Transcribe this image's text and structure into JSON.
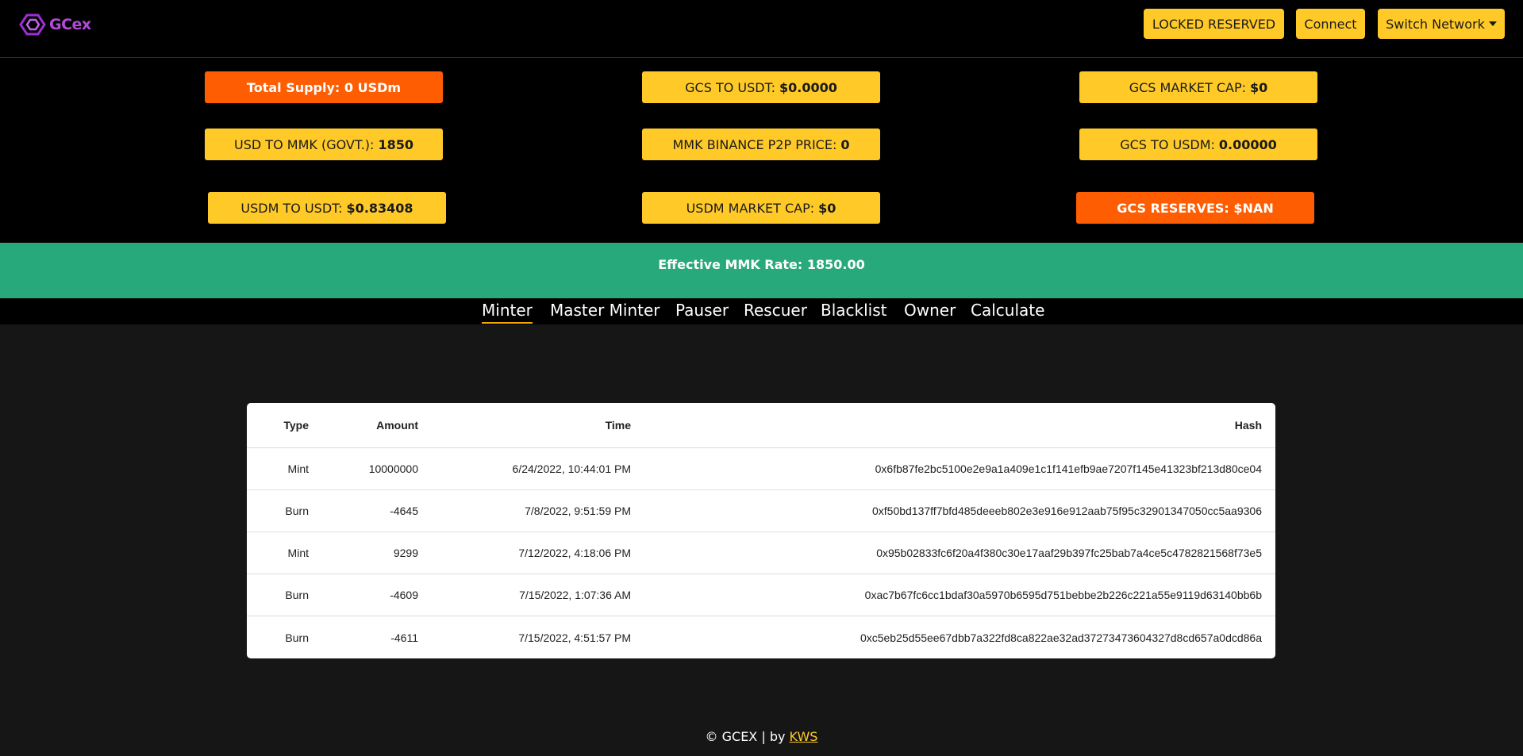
{
  "header": {
    "logo_text": "GCex",
    "locked_reserved_label": "LOCKED RESERVED",
    "connect_label": "Connect",
    "switch_network_label": "Switch Network"
  },
  "stats": {
    "total_supply": {
      "label": "Total Supply:",
      "value": "0 USDm"
    },
    "gcs_to_usdt": {
      "label": "GCS TO USDT:",
      "value": "$0.0000"
    },
    "gcs_market_cap": {
      "label": "GCS MARKET CAP:",
      "value": "$0"
    },
    "usd_to_mmk": {
      "label": "USD TO MMK (GOVT.):",
      "value": "1850"
    },
    "mmk_binance_p2p": {
      "label": "MMK BINANCE P2P PRICE:",
      "value": "0"
    },
    "gcs_to_usdm": {
      "label": "GCS TO USDM:",
      "value": "0.00000"
    },
    "usdm_to_usdt": {
      "label": "USDM TO USDT:",
      "value": "$0.83408"
    },
    "usdm_market_cap": {
      "label": "USDM MARKET CAP:",
      "value": "$0"
    },
    "gcs_reserves": {
      "label": "GCS RESERVES:",
      "value": "$NAN"
    }
  },
  "banner": {
    "text": "Effective MMK Rate: 1850.00"
  },
  "tabs": [
    {
      "label": "Minter",
      "active": true
    },
    {
      "label": "Master Minter"
    },
    {
      "label": "Pauser"
    },
    {
      "label": "Rescuer"
    },
    {
      "label": "Blacklist"
    },
    {
      "label": "Owner"
    },
    {
      "label": "Calculate"
    }
  ],
  "table": {
    "columns": [
      "Type",
      "Amount",
      "Time",
      "Hash"
    ],
    "rows": [
      [
        "Mint",
        "10000000",
        "6/24/2022, 10:44:01 PM",
        "0x6fb87fe2bc5100e2e9a1a409e1c1f141efb9ae7207f145e41323bf213d80ce04"
      ],
      [
        "Burn",
        "-4645",
        "7/8/2022, 9:51:59 PM",
        "0xf50bd137ff7bfd485deeeb802e3e916e912aab75f95c32901347050cc5aa9306"
      ],
      [
        "Mint",
        "9299",
        "7/12/2022, 4:18:06 PM",
        "0x95b02833fc6f20a4f380c30e17aaf29b397fc25bab7a4ce5c4782821568f73e5"
      ],
      [
        "Burn",
        "-4609",
        "7/15/2022, 1:07:36 AM",
        "0xac7b67fc6cc1bdaf30a5970b6595d751bebbe2b226c221a55e9119d63140bb6b"
      ],
      [
        "Burn",
        "-4611",
        "7/15/2022, 4:51:57 PM",
        "0xc5eb25d55ee67dbb7a322fd8ca822ae32ad37273473604327d8cd657a0dcd86a"
      ]
    ]
  },
  "footer": {
    "prefix": "© GCEX | by",
    "link_text": "KWS"
  },
  "colors": {
    "accent": "#ffca28",
    "alert": "#ff5d02",
    "banner": "#28a97c",
    "logo": "#b24bd8"
  }
}
